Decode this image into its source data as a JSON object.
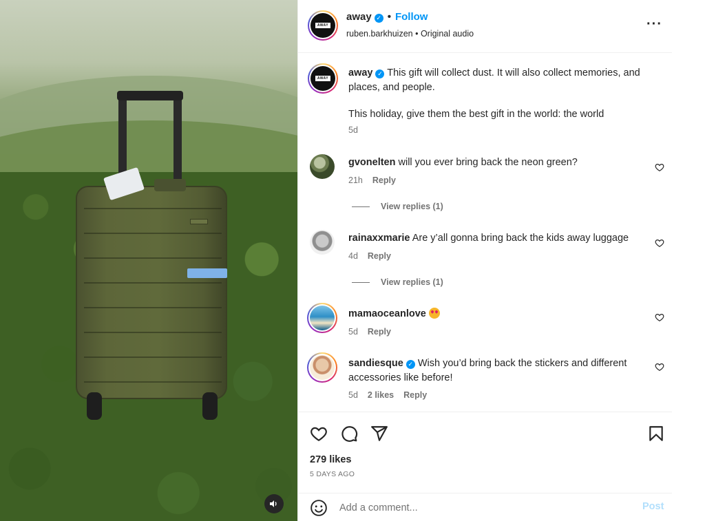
{
  "post": {
    "account": "away",
    "follow_label": "Follow",
    "audio_user": "ruben.barkhuizen",
    "audio_label": "Original audio",
    "logo_text": "AWAY",
    "caption_line1": "This gift will collect dust. It will also collect memories, and places, and people.",
    "caption_line2": "This holiday, give them the best gift in the world: the world",
    "caption_time": "5d"
  },
  "comments": [
    {
      "user": "gvonelten",
      "text": "will you ever bring back the neon green?",
      "time": "21h",
      "likes": "",
      "reply_label": "Reply",
      "view_replies": "View replies (1)"
    },
    {
      "user": "rainaxxmarie",
      "text": "Are y’all gonna bring back the kids away luggage",
      "time": "4d",
      "likes": "",
      "reply_label": "Reply",
      "view_replies": "View replies (1)"
    },
    {
      "user": "mamaoceanlove",
      "text": "",
      "time": "5d",
      "likes": "",
      "reply_label": "Reply",
      "view_replies": ""
    },
    {
      "user": "sandiesque",
      "text": "Wish you’d bring back the stickers and different accessories like before!",
      "time": "5d",
      "likes": "2 likes",
      "reply_label": "Reply",
      "view_replies": ""
    }
  ],
  "stats": {
    "likes": "279 likes",
    "date": "5 DAYS AGO"
  },
  "composer": {
    "placeholder": "Add a comment...",
    "post_label": "Post"
  },
  "icons": {
    "more": "more-options-icon",
    "verified": "verified-badge-icon",
    "like": "heart-icon",
    "comment": "comment-icon",
    "share": "share-icon",
    "save": "bookmark-icon",
    "emoji": "emoji-icon",
    "audio": "speaker-icon"
  },
  "colors": {
    "accent": "#0095f6",
    "text": "#262626",
    "muted": "#737373",
    "post_disabled": "#b2dffc"
  }
}
